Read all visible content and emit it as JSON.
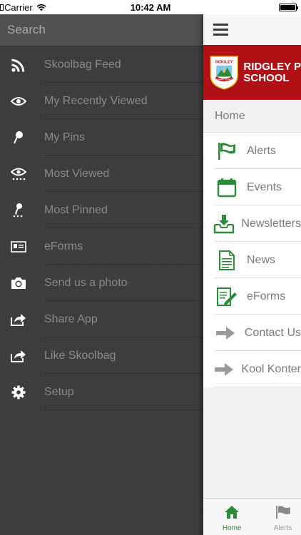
{
  "status_bar": {
    "carrier": "Carrier",
    "time": "10:42 AM"
  },
  "drawer": {
    "search_placeholder": "Search",
    "items": [
      {
        "label": "Skoolbag Feed",
        "icon": "rss-icon"
      },
      {
        "label": "My Recently Viewed",
        "icon": "eye-icon"
      },
      {
        "label": "My Pins",
        "icon": "pin-icon"
      },
      {
        "label": "Most Viewed",
        "icon": "eye-dots-icon"
      },
      {
        "label": "Most Pinned",
        "icon": "pin-dots-icon"
      },
      {
        "label": "eForms",
        "icon": "id-card-icon"
      },
      {
        "label": "Send us a photo",
        "icon": "camera-icon"
      },
      {
        "label": "Share App",
        "icon": "share-icon"
      },
      {
        "label": "Like Skoolbag",
        "icon": "share-icon"
      },
      {
        "label": "Setup",
        "icon": "gear-icon"
      }
    ]
  },
  "main": {
    "school_name_line1": "RIDGLEY P",
    "school_name_line2": "SCHOOL",
    "logo_text_top": "RIDGLEY",
    "logo_text_bottom": "PRIMARY SCHOOL",
    "home_label": "Home",
    "items": [
      {
        "label": "Alerts",
        "icon": "flag-icon"
      },
      {
        "label": "Events",
        "icon": "calendar-icon"
      },
      {
        "label": "Newsletters",
        "icon": "download-tray-icon"
      },
      {
        "label": "News",
        "icon": "document-icon"
      },
      {
        "label": "eForms",
        "icon": "form-pen-icon"
      },
      {
        "label": "Contact Us",
        "icon": "arrow-right-icon"
      },
      {
        "label": "Kool Konter",
        "icon": "arrow-right-icon"
      }
    ]
  },
  "tabbar": {
    "tabs": [
      {
        "label": "Home",
        "icon": "home-icon",
        "active": true
      },
      {
        "label": "Alerts",
        "icon": "flag-icon",
        "active": false
      }
    ]
  },
  "colors": {
    "brand_red": "#b11116",
    "accent_green": "#2e8b3a",
    "drawer_bg": "#3b3b3b"
  }
}
